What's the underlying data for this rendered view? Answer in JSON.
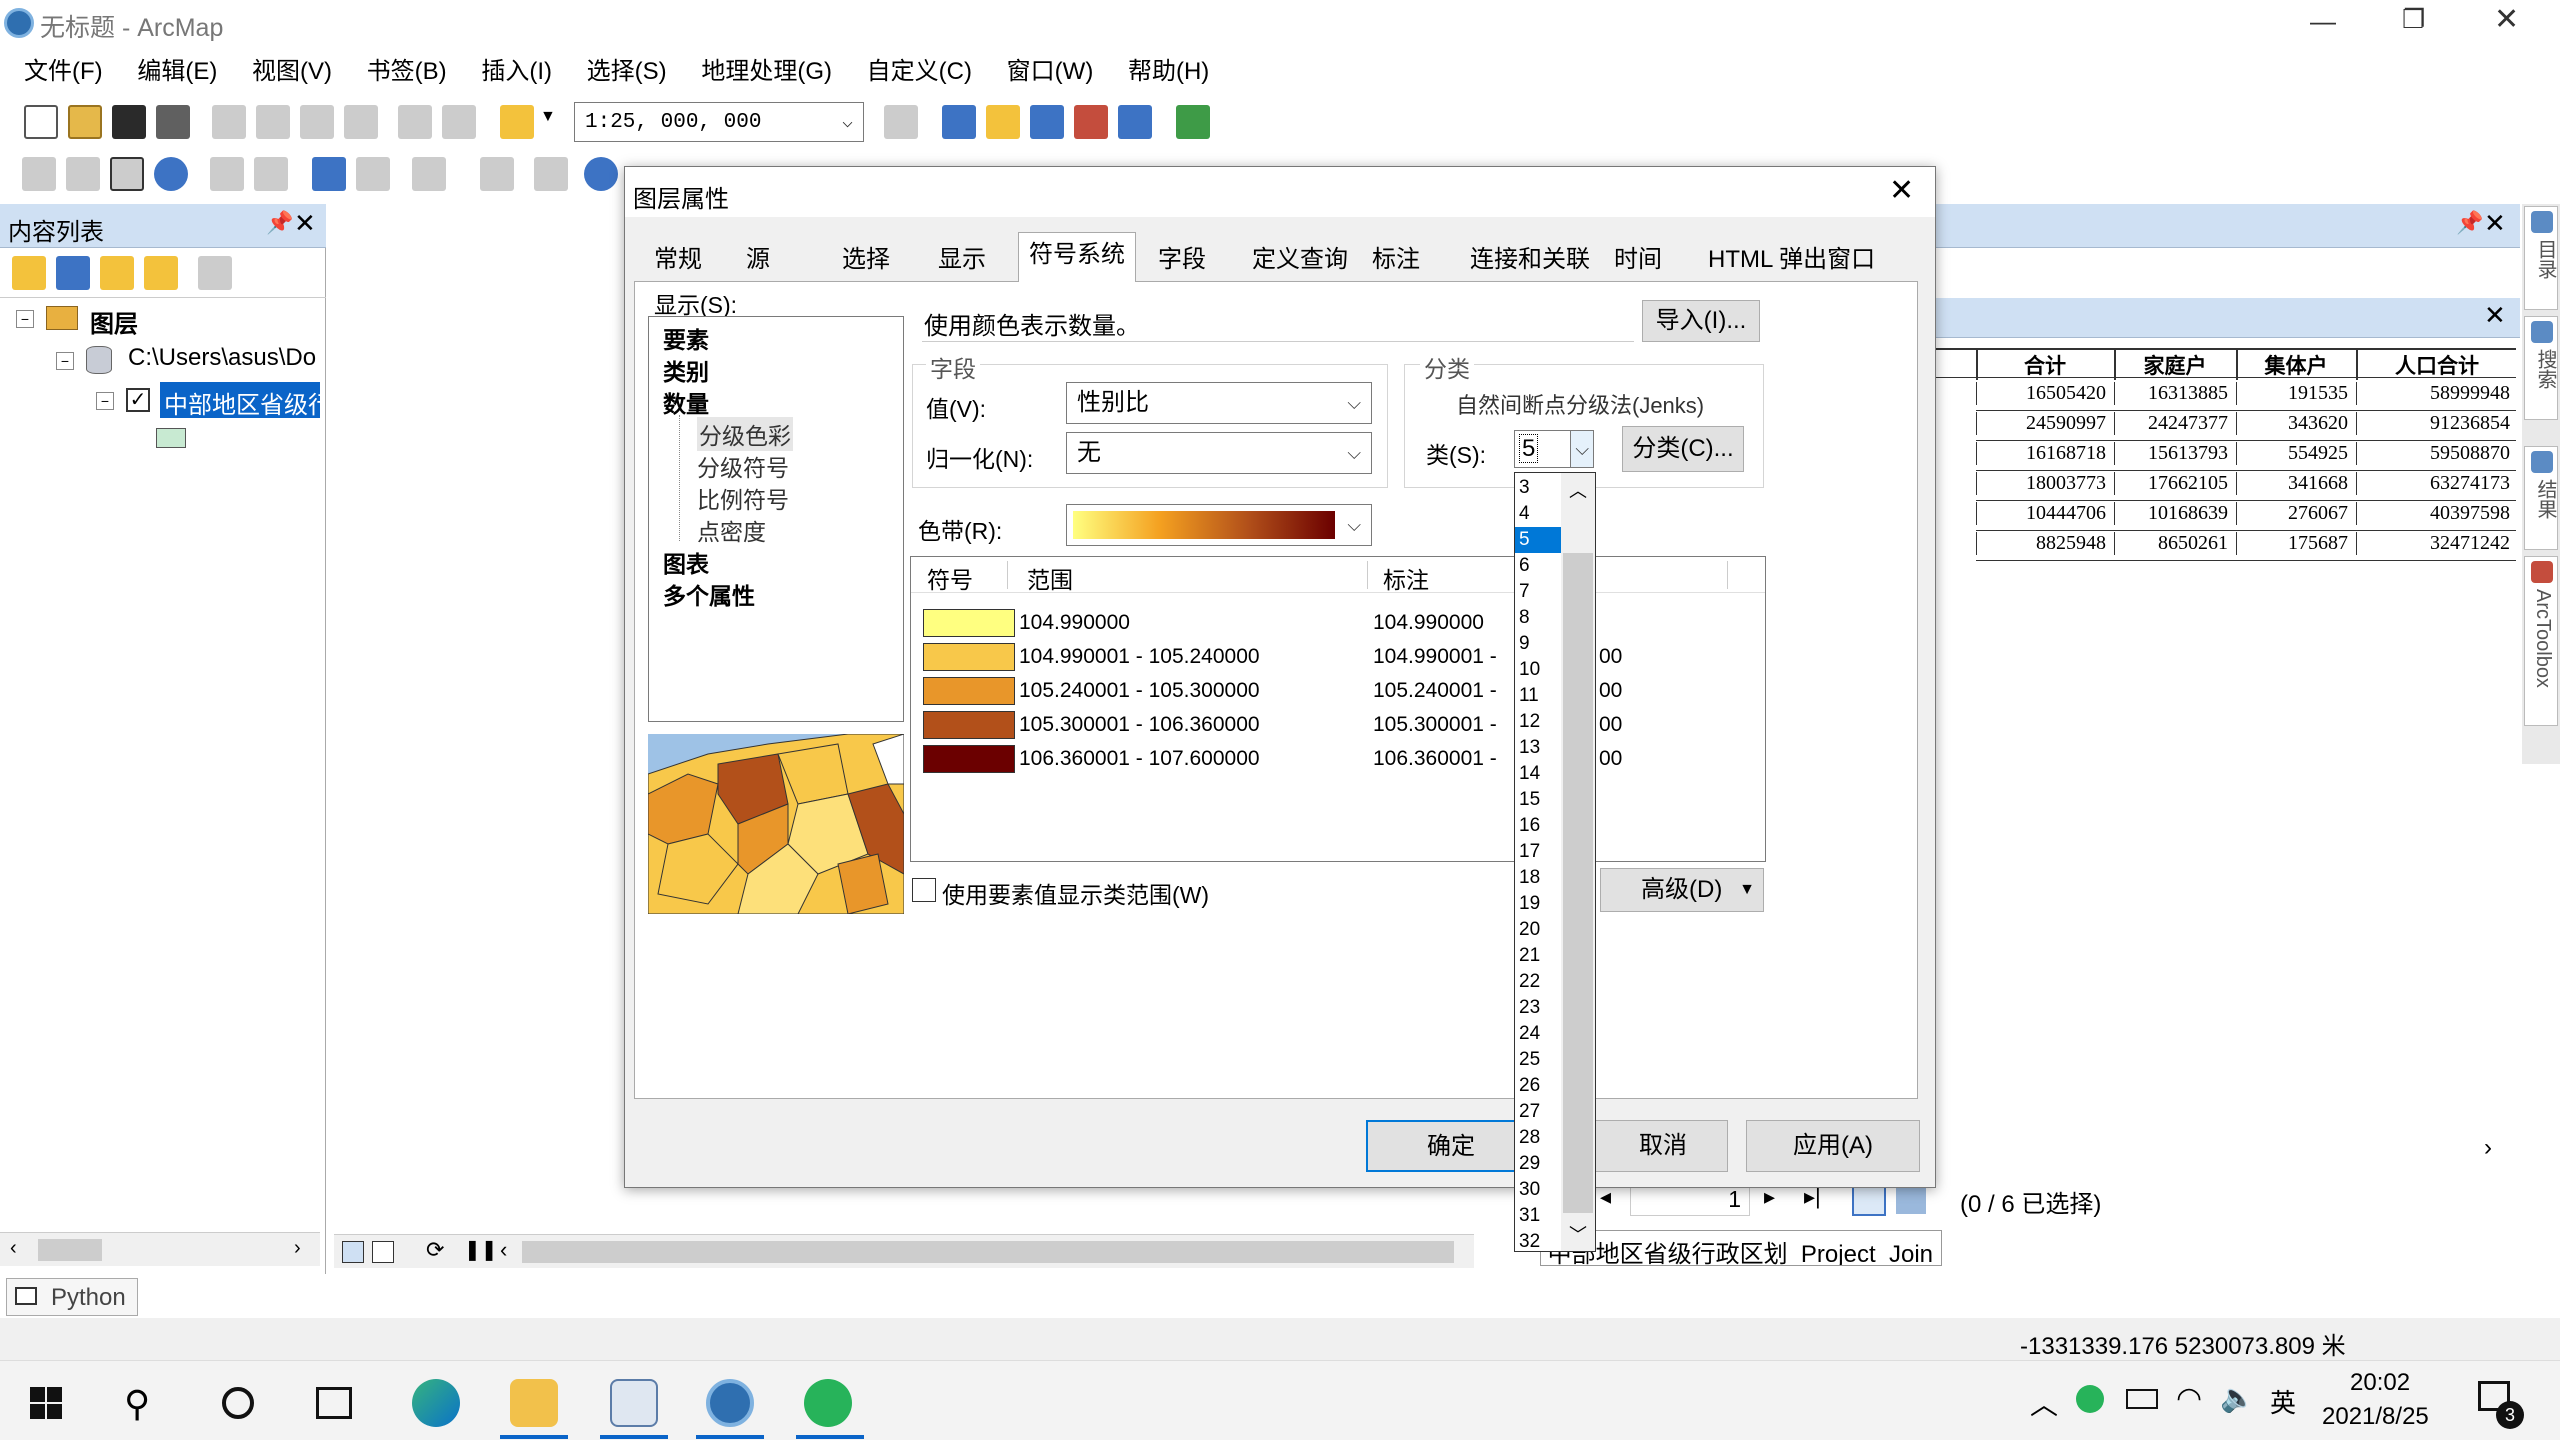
{
  "window": {
    "title": "无标题 - ArcMap"
  },
  "menu": [
    "文件(F)",
    "编辑(E)",
    "视图(V)",
    "书签(B)",
    "插入(I)",
    "选择(S)",
    "地理处理(G)",
    "自定义(C)",
    "窗口(W)",
    "帮助(H)"
  ],
  "toolbar": {
    "scale": "1:25, 000, 000"
  },
  "toc": {
    "title": "内容列表",
    "layers_root": "图层",
    "path": "C:\\Users\\asus\\Do",
    "layer_name": "中部地区省级行"
  },
  "dialog": {
    "title": "图层属性",
    "tabs": [
      "常规",
      "源",
      "选择",
      "显示",
      "符号系统",
      "字段",
      "定义查询",
      "标注",
      "连接和关联",
      "时间",
      "HTML 弹出窗口"
    ],
    "active_tab": "符号系统",
    "show_label": "显示(S):",
    "tree": {
      "top": [
        "要素",
        "类别",
        "数量"
      ],
      "sub": [
        "分级色彩",
        "分级符号",
        "比例符号",
        "点密度"
      ],
      "bottom": [
        "图表",
        "多个属性"
      ]
    },
    "description": "使用颜色表示数量。",
    "import_button": "导入(I)...",
    "fields_group": "字段",
    "value_label": "值(V):",
    "value": "性别比",
    "normalize_label": "归一化(N):",
    "normalize": "无",
    "classification_group": "分类",
    "method": "自然间断点分级法(Jenks)",
    "classes_label": "类(S):",
    "classes_value": "5",
    "classify_button": "分类(C)...",
    "color_ramp_label": "色带(R):",
    "table_headers": [
      "符号",
      "范围",
      "标注"
    ],
    "rows": [
      {
        "color": "#ffff80",
        "range": "104.990000",
        "label": "104.990000",
        "tail": ""
      },
      {
        "color": "#f8c84a",
        "range": "104.990001 - 105.240000",
        "label": "104.990001 -",
        "tail": "00"
      },
      {
        "color": "#e8962a",
        "range": "105.240001 - 105.300000",
        "label": "105.240001 -",
        "tail": "00"
      },
      {
        "color": "#b2501a",
        "range": "105.300001 - 106.360000",
        "label": "105.300001 -",
        "tail": "00"
      },
      {
        "color": "#6b0000",
        "range": "106.360001 - 107.600000",
        "label": "106.360001 -",
        "tail": "00"
      }
    ],
    "show_values_checkbox": "使用要素值显示类范围(W)",
    "advanced_button": "高级(D)",
    "ok": "确定",
    "cancel": "取消",
    "apply": "应用(A)",
    "dropdown_options": [
      "3",
      "4",
      "5",
      "6",
      "7",
      "8",
      "9",
      "10",
      "11",
      "12",
      "13",
      "14",
      "15",
      "16",
      "17",
      "18",
      "19",
      "20",
      "21",
      "22",
      "23",
      "24",
      "25",
      "26",
      "27",
      "28",
      "29",
      "30",
      "31",
      "32"
    ],
    "dropdown_selected": "5"
  },
  "attr_table": {
    "headers": [
      "合计",
      "家庭户",
      "集体户",
      "人口合计"
    ],
    "rows": [
      [
        "16505420",
        "16313885",
        "191535",
        "58999948"
      ],
      [
        "24590997",
        "24247377",
        "343620",
        "91236854"
      ],
      [
        "16168718",
        "15613793",
        "554925",
        "59508870"
      ],
      [
        "18003773",
        "17662105",
        "341668",
        "63274173"
      ],
      [
        "10444706",
        "10168639",
        "276067",
        "40397598"
      ],
      [
        "8825948",
        "8650261",
        "175687",
        "32471242"
      ]
    ],
    "page": "1",
    "selection": "(0 / 6 已选择)",
    "tab_label": "中部地区省级行政区划_Project_Join"
  },
  "right_dock": [
    "目录",
    "搜索",
    "结果",
    "ArcToolbox"
  ],
  "python_button": "Python",
  "status": {
    "coords": "-1331339.176  5230073.809 米"
  },
  "taskbar": {
    "time": "20:02",
    "date": "2021/8/25",
    "ime": "英",
    "badge": "3"
  }
}
